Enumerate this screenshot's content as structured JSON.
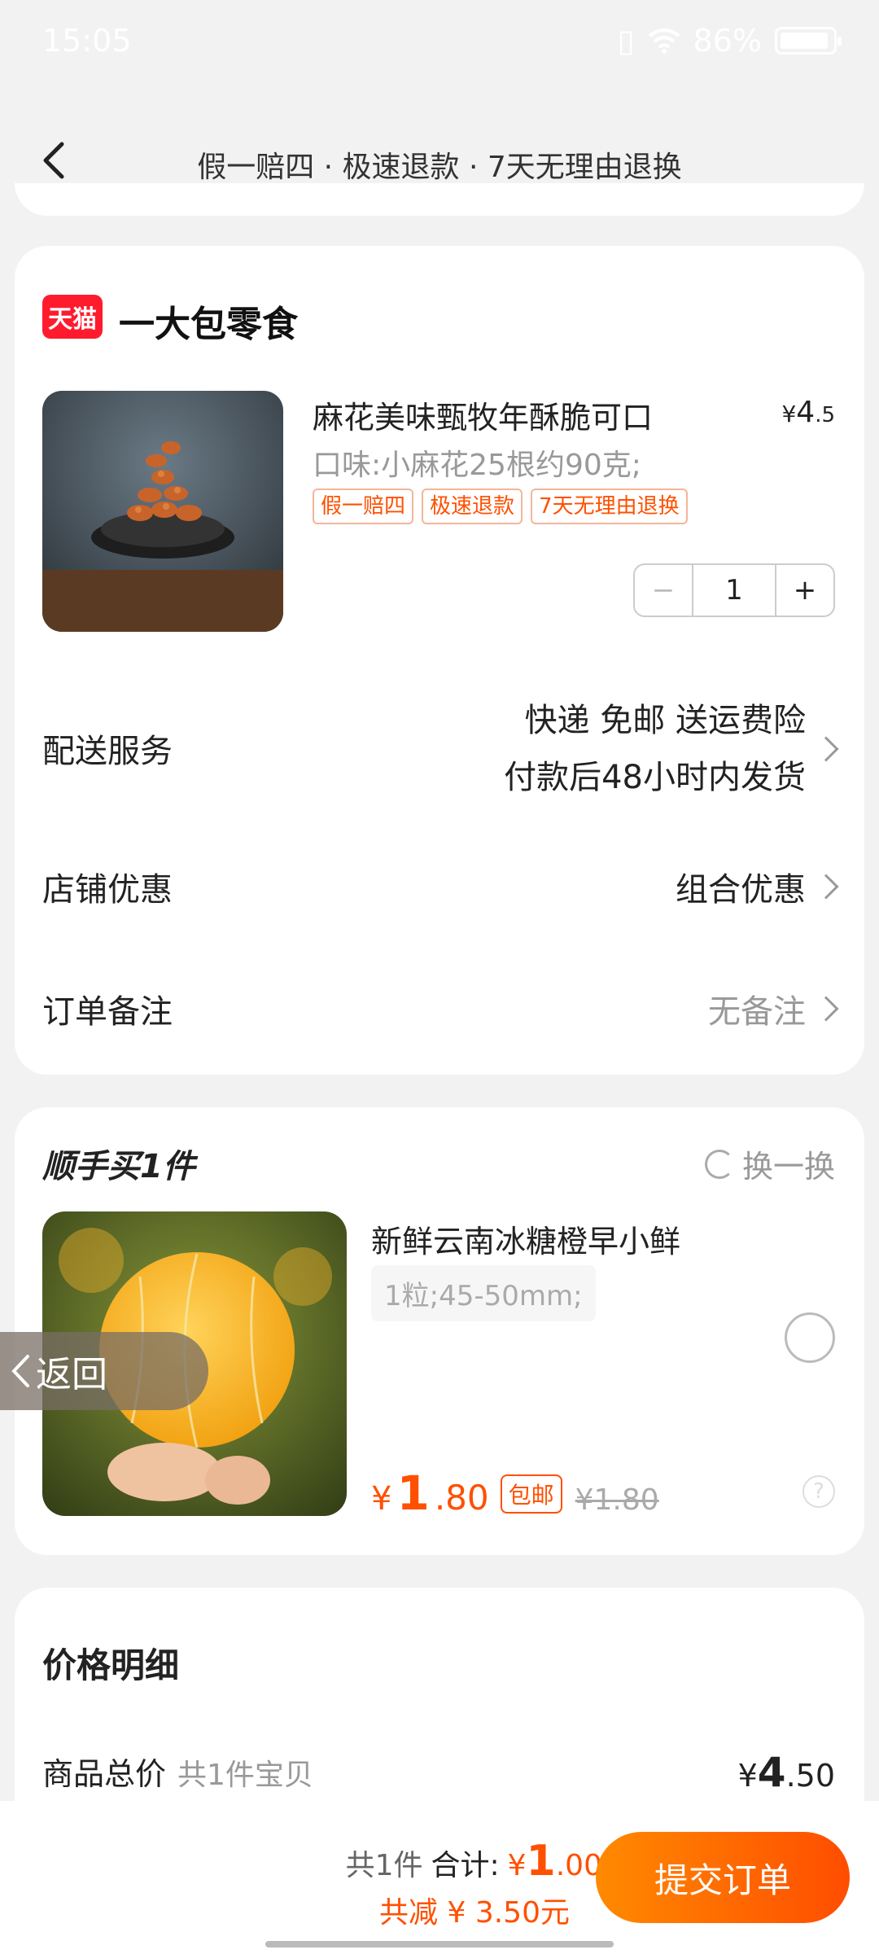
{
  "status": {
    "time": "15:05",
    "battery": "86%"
  },
  "header": {
    "title": "假一赔四 · 极速退款 · 7天无理由退换"
  },
  "store": {
    "badge": "天猫",
    "name": "一大包零食",
    "product": {
      "title": "麻花美味甄牧年酥脆可口",
      "price_currency": "¥",
      "price_int": "4",
      "price_dec": ".5",
      "sku": "口味:小麻花25根约90克;",
      "tags": [
        "假一赔四",
        "极速退款",
        "7天无理由退换"
      ],
      "quantity": "1",
      "minus": "−",
      "plus": "+"
    },
    "rows": {
      "delivery_label": "配送服务",
      "delivery_line1": "快递 免邮 送运费险",
      "delivery_line2": "付款后48小时内发货",
      "discount_label": "店铺优惠",
      "discount_value": "组合优惠",
      "note_label": "订单备注",
      "note_value": "无备注"
    }
  },
  "recommend": {
    "title": "顺手买1件",
    "swap": "换一换",
    "item": {
      "name": "新鲜云南冰糖橙早小鲜",
      "sku": "1粒;45-50mm;",
      "price_currency": "¥",
      "price_int": "1",
      "price_dec": ".80",
      "free_ship": "包邮",
      "orig_price": "¥1.80",
      "help": "?"
    }
  },
  "float_back": {
    "label": "返回"
  },
  "price_detail": {
    "title": "价格明细",
    "total_label": "商品总价",
    "total_sub": "共1件宝贝",
    "total_currency": "¥",
    "total_int": "4",
    "total_dec": ".50"
  },
  "bottom": {
    "count": "共1件",
    "sum_label": "合计:",
    "sum_currency": "¥",
    "sum_int": "1",
    "sum_dec": ".00",
    "discount": "共减 ¥ 3.50元",
    "submit": "提交订单"
  },
  "colors": {
    "accent": "#ff5000",
    "tmall": "#ff1b2e",
    "background": "#f2f2f2"
  }
}
